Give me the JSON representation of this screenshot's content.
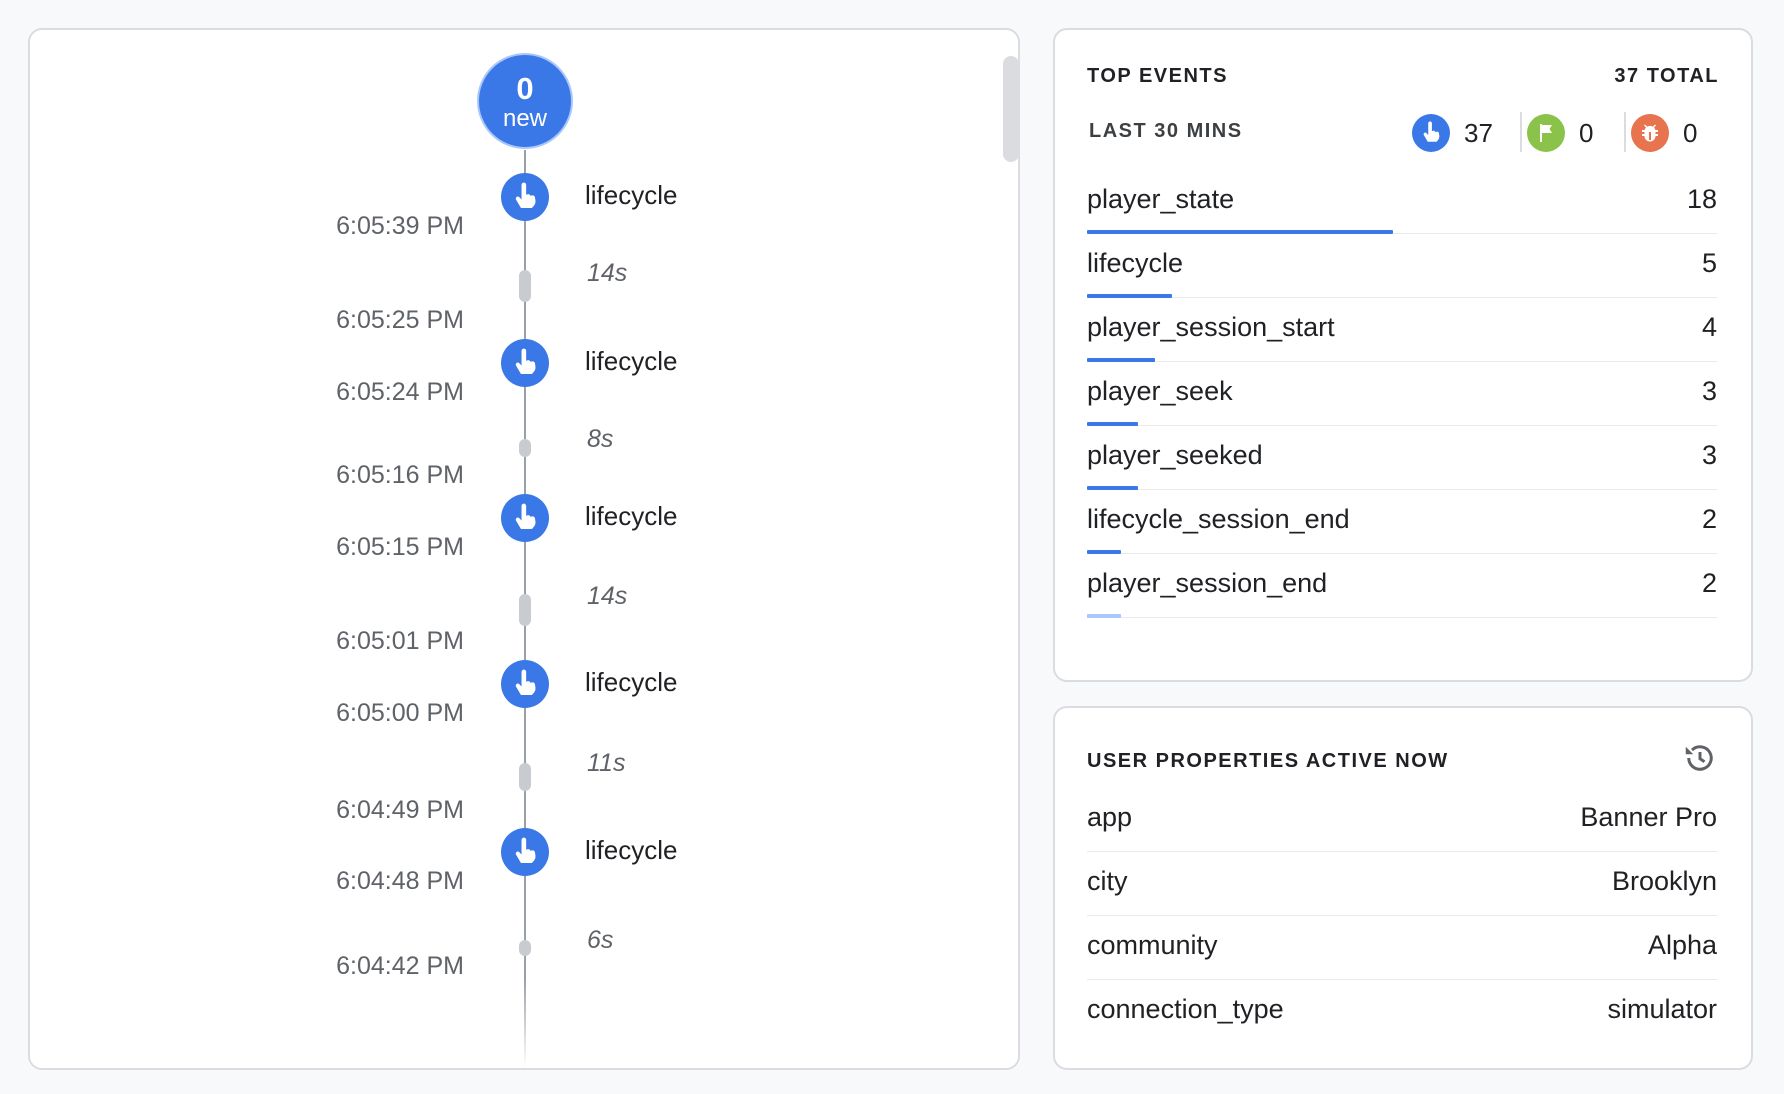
{
  "timeline": {
    "new_count": "0",
    "new_label": "new",
    "events": [
      {
        "label": "lifecycle",
        "start": "6:05:39 PM",
        "gap": "14s"
      },
      {
        "label": "lifecycle",
        "end": "6:05:25 PM",
        "start": "6:05:24 PM",
        "gap": "8s"
      },
      {
        "label": "lifecycle",
        "end": "6:05:16 PM",
        "start": "6:05:15 PM",
        "gap": "14s"
      },
      {
        "label": "lifecycle",
        "end": "6:05:01 PM",
        "start": "6:05:00 PM",
        "gap": "11s"
      },
      {
        "label": "lifecycle",
        "end": "6:04:49 PM",
        "start": "6:04:48 PM",
        "gap": "6s"
      }
    ],
    "last_timestamp": "6:04:42 PM",
    "event_icon": "touch-icon"
  },
  "top_events": {
    "title": "TOP EVENTS",
    "total": "37 TOTAL",
    "period": "LAST 30 MINS",
    "counters": [
      {
        "icon": "touch-icon",
        "value": "37",
        "color": "#3b78e7"
      },
      {
        "icon": "flag-icon",
        "value": "0",
        "color": "#8bc34a"
      },
      {
        "icon": "bug-icon",
        "value": "0",
        "color": "#e8744f"
      }
    ],
    "max": 18,
    "rows": [
      {
        "name": "player_state",
        "count": "18",
        "value": 18
      },
      {
        "name": "lifecycle",
        "count": "5",
        "value": 5
      },
      {
        "name": "player_session_start",
        "count": "4",
        "value": 4
      },
      {
        "name": "player_seek",
        "count": "3",
        "value": 3
      },
      {
        "name": "player_seeked",
        "count": "3",
        "value": 3
      },
      {
        "name": "lifecycle_session_end",
        "count": "2",
        "value": 2
      },
      {
        "name": "player_session_end",
        "count": "2",
        "value": 2
      }
    ]
  },
  "user_properties": {
    "title": "USER PROPERTIES ACTIVE NOW",
    "history_icon": "history-icon",
    "rows": [
      {
        "key": "app",
        "value": "Banner Pro"
      },
      {
        "key": "city",
        "value": "Brooklyn"
      },
      {
        "key": "community",
        "value": "Alpha"
      },
      {
        "key": "connection_type",
        "value": "simulator"
      }
    ]
  },
  "colors": {
    "accent": "#3b78e7",
    "divider": "#dadce0"
  }
}
